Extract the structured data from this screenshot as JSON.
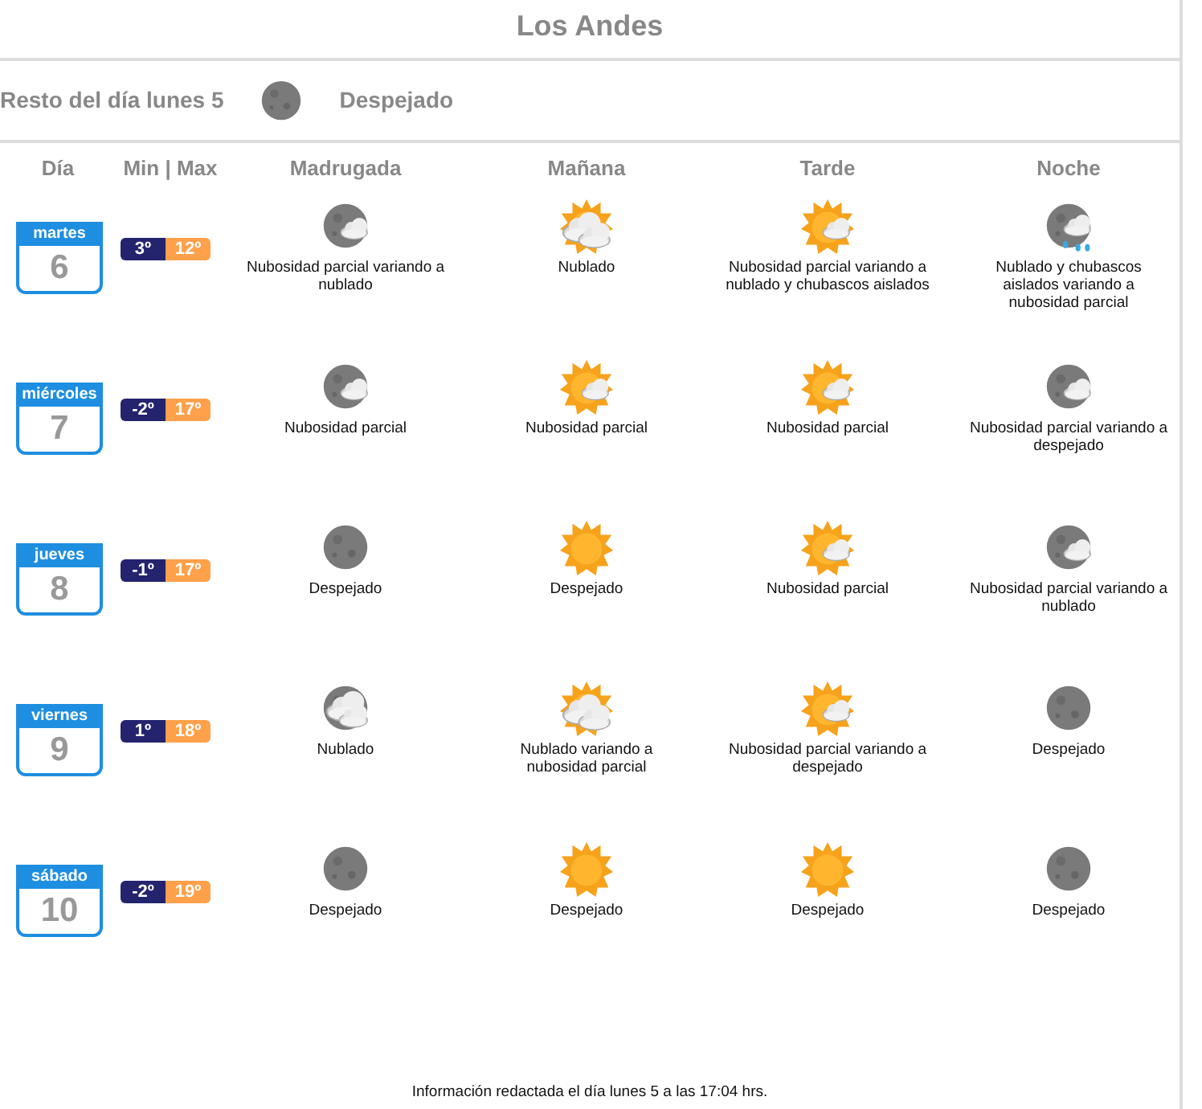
{
  "title": "Los Andes",
  "rest_of_day": {
    "label": "Resto del día lunes 5",
    "kind": "moon",
    "condition": "Despejado"
  },
  "columns": [
    "Día",
    "Min | Max",
    "Madrugada",
    "Mañana",
    "Tarde",
    "Noche"
  ],
  "days": [
    {
      "weekday": "martes",
      "date": "6",
      "min": "3º",
      "max": "12º",
      "periods": [
        {
          "kind": "moon-cloud",
          "text": "Nubosidad parcial variando a nublado"
        },
        {
          "kind": "sun-cloudy",
          "text": "Nublado"
        },
        {
          "kind": "sun-cloud",
          "text": "Nubosidad parcial variando a nublado y chubascos aislados"
        },
        {
          "kind": "moon-rain",
          "text": "Nublado y chubascos aislados variando a nubosidad parcial"
        }
      ]
    },
    {
      "weekday": "miércoles",
      "date": "7",
      "min": "-2º",
      "max": "17º",
      "periods": [
        {
          "kind": "moon-cloud",
          "text": "Nubosidad parcial"
        },
        {
          "kind": "sun-cloud",
          "text": "Nubosidad parcial"
        },
        {
          "kind": "sun-cloud",
          "text": "Nubosidad parcial"
        },
        {
          "kind": "moon-cloud",
          "text": "Nubosidad parcial variando a despejado"
        }
      ]
    },
    {
      "weekday": "jueves",
      "date": "8",
      "min": "-1º",
      "max": "17º",
      "periods": [
        {
          "kind": "moon",
          "text": "Despejado"
        },
        {
          "kind": "sun",
          "text": "Despejado"
        },
        {
          "kind": "sun-cloud",
          "text": "Nubosidad parcial"
        },
        {
          "kind": "moon-cloud",
          "text": "Nubosidad parcial variando a nublado"
        }
      ]
    },
    {
      "weekday": "viernes",
      "date": "9",
      "min": "1º",
      "max": "18º",
      "periods": [
        {
          "kind": "moon-cloudy",
          "text": "Nublado"
        },
        {
          "kind": "sun-cloudy",
          "text": "Nublado variando a nubosidad parcial"
        },
        {
          "kind": "sun-cloud",
          "text": "Nubosidad parcial variando a despejado"
        },
        {
          "kind": "moon",
          "text": "Despejado"
        }
      ]
    },
    {
      "weekday": "sábado",
      "date": "10",
      "min": "-2º",
      "max": "19º",
      "periods": [
        {
          "kind": "moon",
          "text": "Despejado"
        },
        {
          "kind": "sun",
          "text": "Despejado"
        },
        {
          "kind": "sun",
          "text": "Despejado"
        },
        {
          "kind": "moon",
          "text": "Despejado"
        }
      ]
    }
  ],
  "footer": "Información redactada el día lunes 5 a las 17:04 hrs."
}
